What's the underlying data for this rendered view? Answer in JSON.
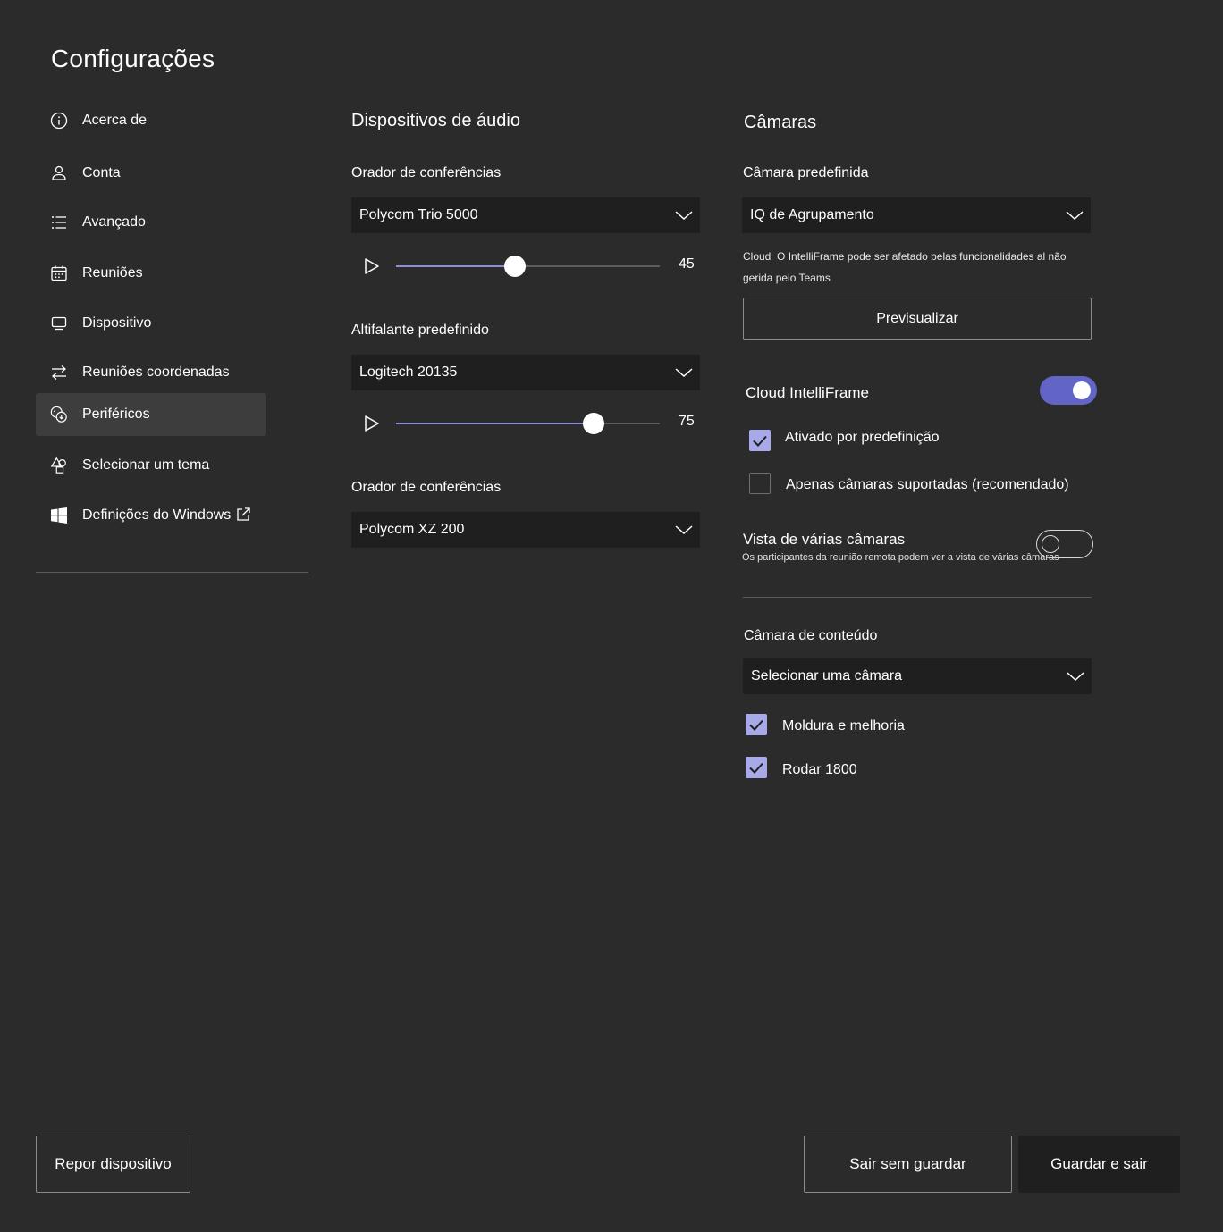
{
  "app": {
    "title": "Configurações"
  },
  "sidebar": {
    "items": [
      {
        "label": "Acerca de",
        "icon": "info-icon"
      },
      {
        "label": "Conta",
        "icon": "account-icon"
      },
      {
        "label": "Avançado",
        "icon": "list-icon"
      },
      {
        "label": "Reuniões",
        "icon": "calendar-icon"
      },
      {
        "label": "Dispositivo",
        "icon": "monitor-icon"
      },
      {
        "label": "Reuniões coordenadas",
        "icon": "swap-arrows-icon"
      },
      {
        "label": "Periféricos",
        "icon": "peripherals-icon",
        "active": true
      },
      {
        "label": "Selecionar um tema",
        "icon": "shapes-icon"
      },
      {
        "label": "Definições do Windows",
        "icon": "windows-icon",
        "external_icon": "external-link-icon"
      }
    ]
  },
  "audio": {
    "title": "Dispositivos de áudio",
    "conference_speaker": {
      "label": "Orador de conferências",
      "value": "Polycom Trio 5000",
      "volume": 45,
      "volume_text": "45"
    },
    "default_speaker": {
      "label": "Altifalante predefinido",
      "value": "Logitech 20135",
      "volume": 75,
      "volume_text": "75"
    },
    "conference_mic": {
      "label": "Orador de conferências",
      "value": "Polycom XZ 200"
    }
  },
  "cameras": {
    "title": "Câmaras",
    "default_camera": {
      "label": "Câmara predefinida",
      "value": "IQ de Agrupamento"
    },
    "note_prefix": "Cloud",
    "note_line1": "O IntelliFrame pode ser afetado pelas funcionalidades al não",
    "note_line2": "gerida pelo Teams",
    "preview_label": "Previsualizar",
    "intelliframe": {
      "label": "Cloud IntelliFrame",
      "enabled": true,
      "options": [
        {
          "label": "Ativado por predefinição",
          "checked": true
        },
        {
          "label": "Apenas câmaras suportadas (recomendado)",
          "checked": false
        }
      ]
    },
    "multi_camera": {
      "label": "Vista de várias câmaras",
      "description": "Os participantes da reunião remota podem ver a vista de várias câmaras",
      "enabled": false
    },
    "content_camera": {
      "label": "Câmara de conteúdo",
      "value": "Selecionar uma câmara",
      "options": [
        {
          "label": "Moldura e melhoria",
          "checked": true
        },
        {
          "label": "Rodar 1800",
          "checked": true
        }
      ]
    }
  },
  "footer": {
    "reset_label": "Repor dispositivo",
    "exit_label": "Sair sem guardar",
    "save_label": "Guardar e sair"
  },
  "colors": {
    "background": "#2b2b2b",
    "dropdown_bg": "#1f1f1f",
    "accent": "#6264c6",
    "checkbox_checked": "#a8a9e8",
    "slider_fill": "#8b8fd6",
    "active_nav": "#3d3d3d"
  }
}
